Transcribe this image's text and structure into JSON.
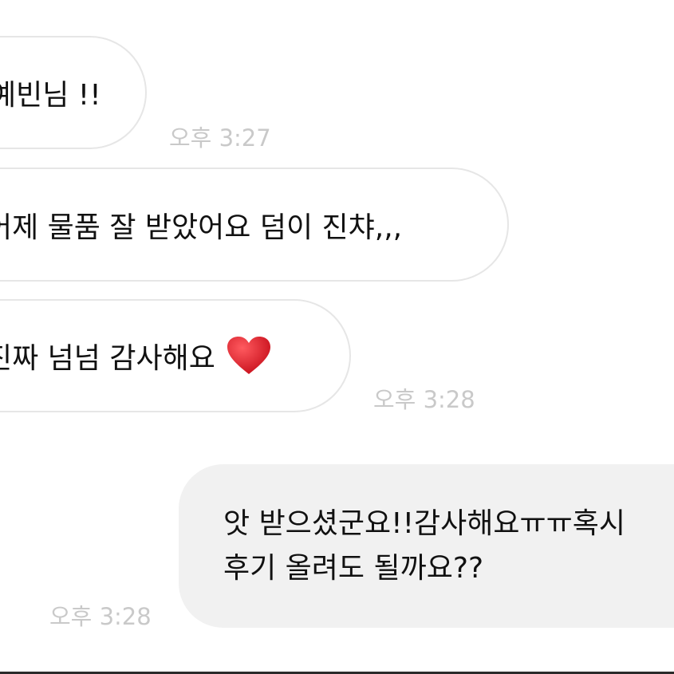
{
  "messages": [
    {
      "direction": "received",
      "text": "예빈님 !!",
      "time": "오후 3:27"
    },
    {
      "direction": "received",
      "text": "어제 물품 잘 받았어요 덤이 진챠,,,"
    },
    {
      "direction": "received",
      "text": "진짜 넘넘 감사해요",
      "emoji": "heart-icon",
      "time": "오후 3:28"
    },
    {
      "direction": "sent",
      "lines": [
        "앗 받으셨군요!!감사해요ㅠㅠ혹시",
        "후기 올려도 될까요??"
      ],
      "time": "오후 3:28"
    }
  ],
  "colors": {
    "received_bubble_border": "#e6e6e6",
    "sent_bubble_bg": "#f1f1f1",
    "timestamp": "#c9c9c9",
    "heart": "#d8202a"
  }
}
